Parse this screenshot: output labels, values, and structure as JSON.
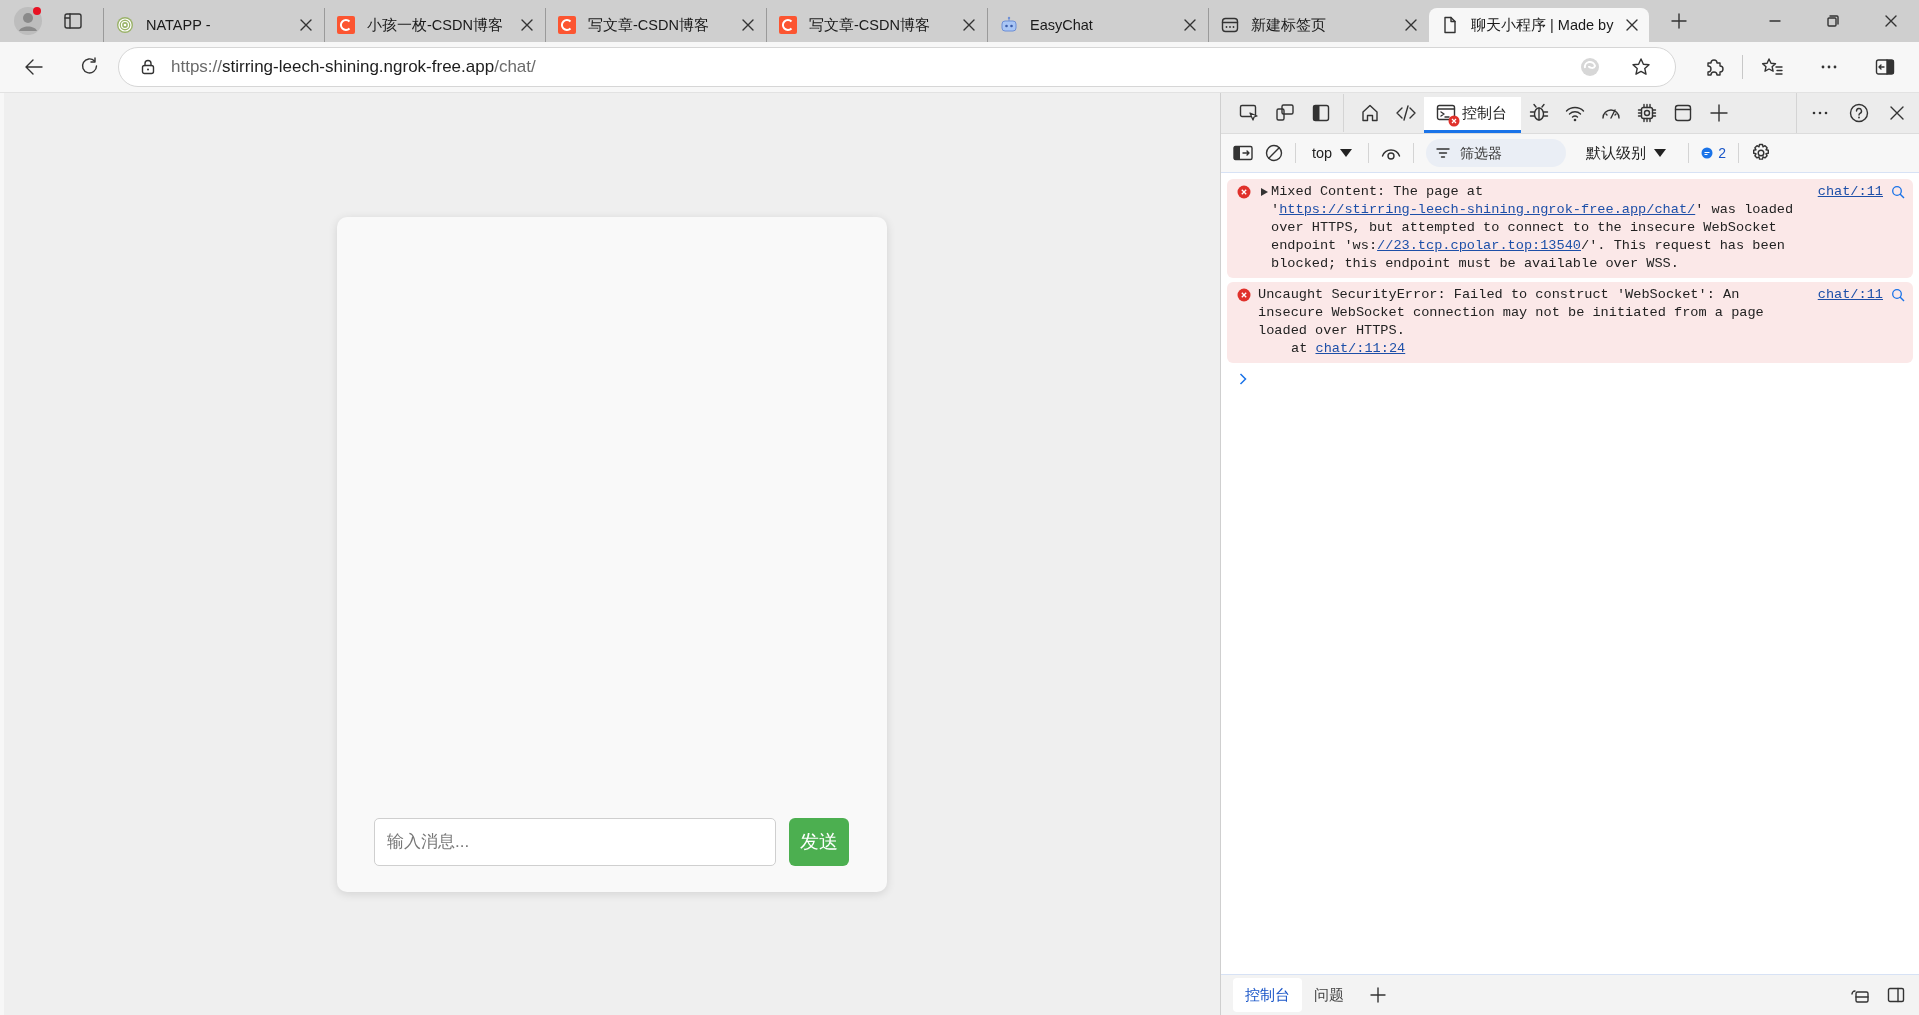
{
  "browser_tabs": [
    {
      "title": "NATAPP -",
      "kind": "rings",
      "selected": false
    },
    {
      "title": "小孩一枚-CSDN博客",
      "kind": "csdn",
      "selected": false
    },
    {
      "title": "写文章-CSDN博客",
      "kind": "csdn",
      "selected": false
    },
    {
      "title": "写文章-CSDN博客",
      "kind": "csdn",
      "selected": false
    },
    {
      "title": "EasyChat",
      "kind": "robot",
      "selected": false
    },
    {
      "title": "新建标签页",
      "kind": "newtab",
      "selected": false
    },
    {
      "title": "聊天小程序 | Made by",
      "kind": "page",
      "selected": true
    }
  ],
  "address_bar": {
    "scheme": "https://",
    "host": "stirring-leech-shining.ngrok-free.app",
    "path": "/chat/"
  },
  "chat": {
    "input": {
      "placeholder": "输入消息..."
    },
    "send_button": "发送"
  },
  "devtools": {
    "tools": [
      {
        "kind": "inspect",
        "selected": false
      },
      {
        "kind": "device",
        "selected": false
      },
      {
        "kind": "dock",
        "selected": false
      },
      {
        "kind": "home",
        "selected": false
      },
      {
        "kind": "elements",
        "selected": false
      },
      {
        "kind": "console",
        "label": "控制台",
        "selected": true,
        "has_errors": true
      },
      {
        "kind": "sources",
        "selected": false
      },
      {
        "kind": "network",
        "selected": false
      },
      {
        "kind": "performance",
        "selected": false
      },
      {
        "kind": "memory",
        "selected": false
      },
      {
        "kind": "application",
        "selected": false
      },
      {
        "kind": "add",
        "selected": false
      }
    ],
    "context": "top",
    "filter": {
      "placeholder": "筛选器"
    },
    "log_level": "默认级别",
    "message_count": "2",
    "messages": [
      {
        "kind": "error",
        "expanded": false,
        "source": "chat/:11",
        "parts": [
          {
            "text": "Mixed Content: The page at '"
          },
          {
            "text": "https://stirring-leech-shining.ngrok-free.app/chat/",
            "link": true
          },
          {
            "text": "' was loaded over HTTPS, but attempted to connect to the insecure WebSocket endpoint 'ws:"
          },
          {
            "text": "//23.tcp.cpolar.top:13540",
            "link": true
          },
          {
            "text": "/'. This request has been blocked; this endpoint must be available over WSS."
          }
        ]
      },
      {
        "kind": "error",
        "source": "chat/:11",
        "parts": [
          {
            "text": "Uncaught SecurityError: Failed to construct 'WebSocket': An insecure WebSocket connection may not be initiated from a page loaded over HTTPS."
          }
        ],
        "stack": {
          "prefix": "at",
          "link": "chat/:11:24"
        }
      }
    ],
    "drawer_tabs": [
      {
        "label": "控制台",
        "selected": true
      },
      {
        "label": "问题",
        "selected": false
      }
    ]
  }
}
